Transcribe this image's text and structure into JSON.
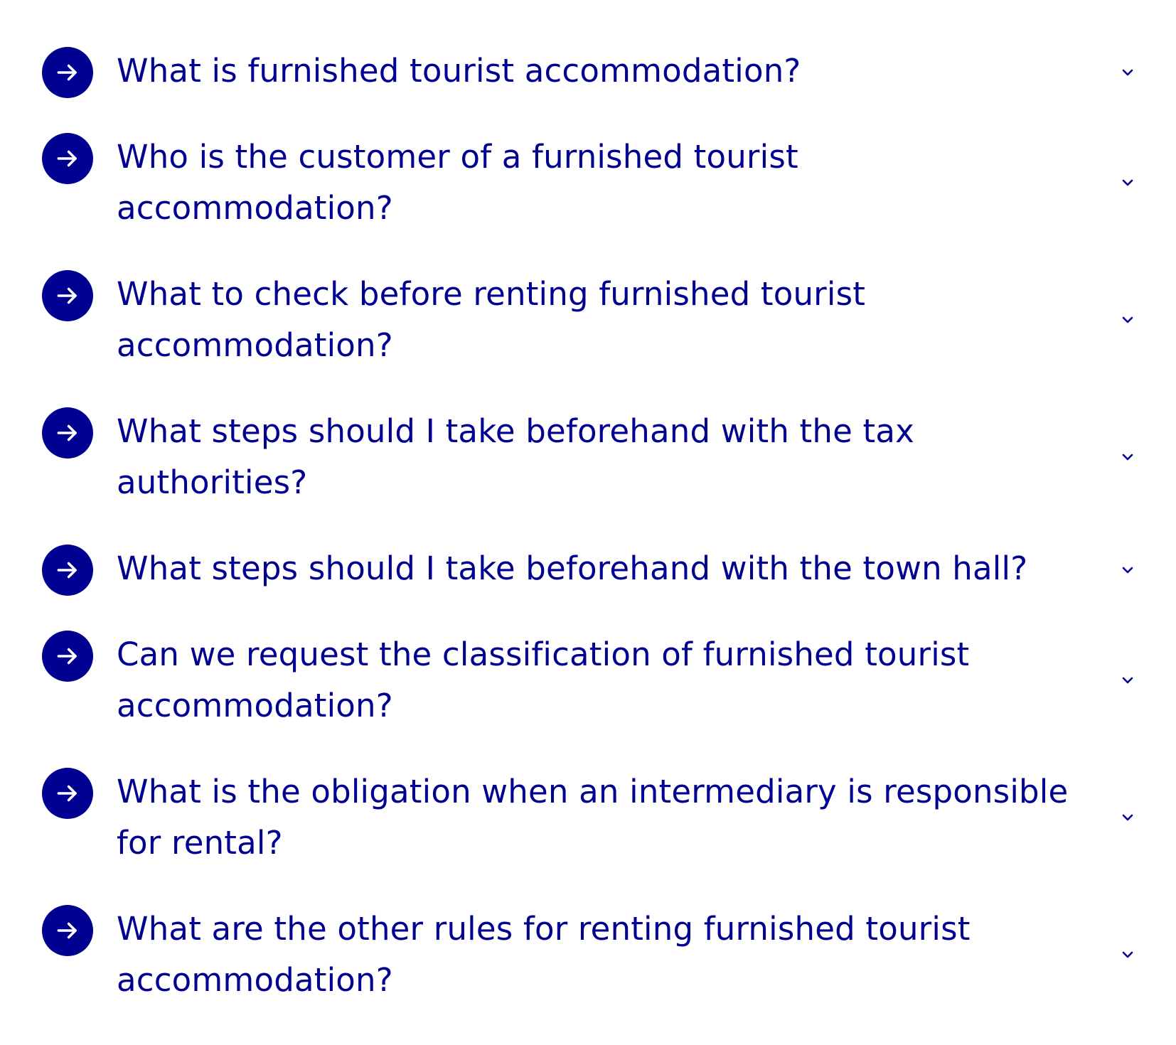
{
  "faq": {
    "items": [
      {
        "question": "What is furnished tourist accommodation?",
        "arrow_icon": "arrow-right-icon",
        "toggle_icon": "chevron-down-icon"
      },
      {
        "question": "Who is the customer of a furnished tourist accommodation?",
        "arrow_icon": "arrow-right-icon",
        "toggle_icon": "chevron-down-icon"
      },
      {
        "question": "What to check before renting furnished tourist accommodation?",
        "arrow_icon": "arrow-right-icon",
        "toggle_icon": "chevron-down-icon"
      },
      {
        "question": "What steps should I take beforehand with the tax authorities?",
        "arrow_icon": "arrow-right-icon",
        "toggle_icon": "chevron-down-icon"
      },
      {
        "question": "What steps should I take beforehand with the town hall?",
        "arrow_icon": "arrow-right-icon",
        "toggle_icon": "chevron-down-icon"
      },
      {
        "question": "Can we request the classification of furnished tourist accommodation?",
        "arrow_icon": "arrow-right-icon",
        "toggle_icon": "chevron-down-icon"
      },
      {
        "question": "What is the obligation when an intermediary is responsible for rental?",
        "arrow_icon": "arrow-right-icon",
        "toggle_icon": "chevron-down-icon"
      },
      {
        "question": "What are the other rules for renting furnished tourist accommodation?",
        "arrow_icon": "arrow-right-icon",
        "toggle_icon": "chevron-down-icon"
      }
    ]
  },
  "colors": {
    "accent": "#000091",
    "icon_foreground": "#ffffff",
    "background": "#ffffff"
  }
}
